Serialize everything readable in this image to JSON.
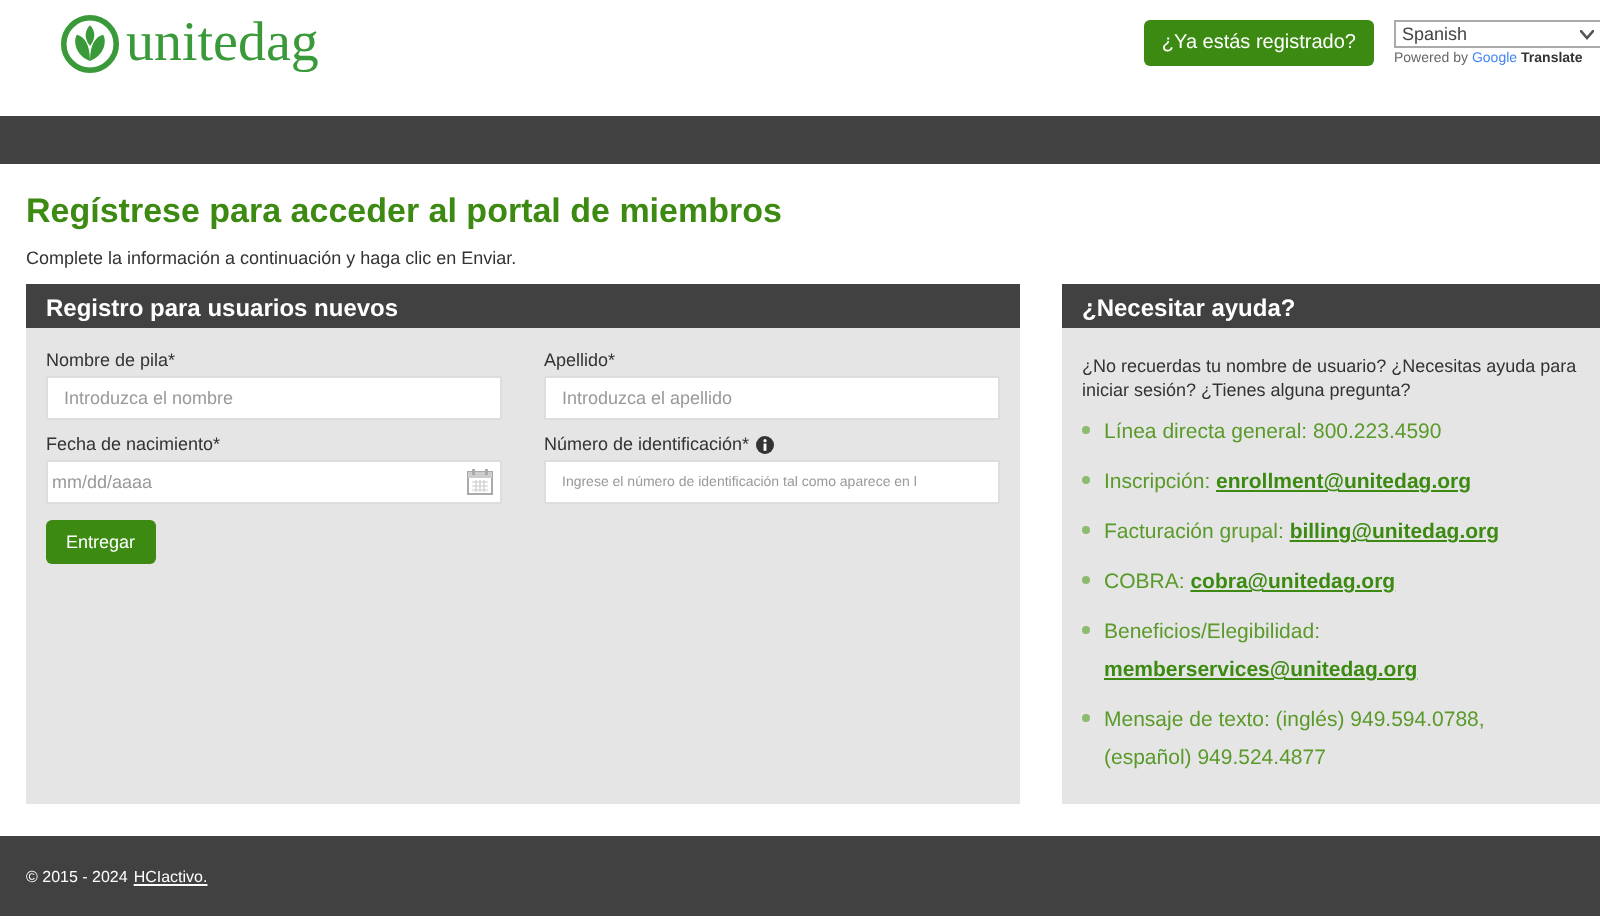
{
  "header": {
    "logo": "unitedag",
    "login_button": "¿Ya estás registrado?",
    "language_select": {
      "value": "Spanish"
    },
    "powered_by": "Powered by",
    "google": "Google",
    "translate": "Translate"
  },
  "page": {
    "title": "Regístrese para acceder al portal de miembros",
    "subtitle": "Complete la información a continuación y haga clic en Enviar."
  },
  "form": {
    "title": "Registro para usuarios nuevos",
    "fields": [
      {
        "label": "Nombre de pila*",
        "placeholder": "Introduzca el nombre",
        "kind": "text",
        "info": false
      },
      {
        "label": "Apellido*",
        "placeholder": "Introduzca el apellido",
        "kind": "text",
        "info": false
      },
      {
        "label": "Fecha de nacimiento*",
        "placeholder": "mm/dd/aaaa",
        "kind": "date",
        "info": false
      },
      {
        "label": "Número de identificación*",
        "placeholder": "Ingrese el número de identificación tal como aparece en l",
        "kind": "text",
        "info": true
      }
    ],
    "submit": "Entregar"
  },
  "help": {
    "title": "¿Necesitar ayuda?",
    "intro": "¿No recuerdas tu nombre de usuario? ¿Necesitas ayuda para iniciar sesión? ¿Tienes alguna pregunta?",
    "items": [
      {
        "text": "Línea directa general: 800.223.4590"
      },
      {
        "text": "Inscripción:",
        "link": "enrollment@unitedag.org"
      },
      {
        "text": "Facturación grupal:",
        "link": "billing@unitedag.org"
      },
      {
        "text": "COBRA:",
        "link": "cobra@unitedag.org"
      },
      {
        "text": "Beneficios/Elegibilidad:",
        "link": "memberservices@unitedag.org"
      },
      {
        "text": "Mensaje de texto: (inglés) 949.594.0788, (español) 949.524.4877"
      }
    ]
  },
  "footer": {
    "copyright": "© 2015 - 2024",
    "link": "HCIactivo."
  }
}
